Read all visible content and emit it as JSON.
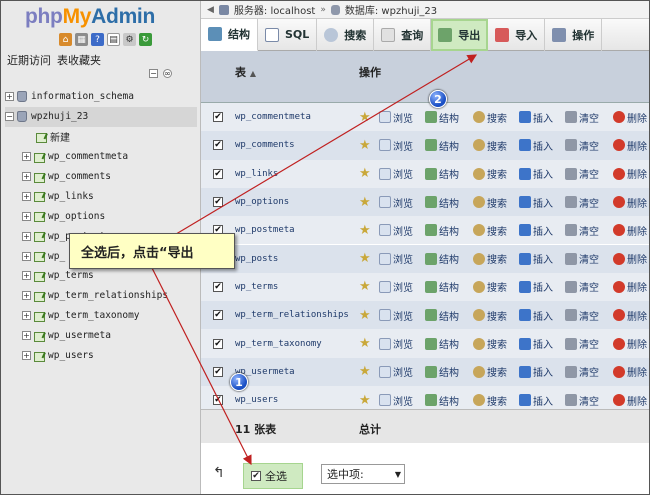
{
  "logo": {
    "php": "php",
    "my": "My",
    "admin": "Admin"
  },
  "sidebar": {
    "recent": "近期访问",
    "favorites": "表收藏夹",
    "tree": {
      "db_info_schema": "information_schema",
      "db_current": "wpzhuji_23",
      "new": "新建",
      "tables": [
        "wp_commentmeta",
        "wp_comments",
        "wp_links",
        "wp_options",
        "wp_postmeta",
        "wp_",
        "wp_terms",
        "wp_term_relationships",
        "wp_term_taxonomy",
        "wp_usermeta",
        "wp_users"
      ]
    }
  },
  "breadcrumb": {
    "server": "服务器: localhost",
    "database": "数据库: wpzhuji_23"
  },
  "tabs": [
    {
      "label": "结构",
      "icon": "structure-icon"
    },
    {
      "label": "SQL",
      "icon": "sql-icon"
    },
    {
      "label": "搜索",
      "icon": "search-icon"
    },
    {
      "label": "查询",
      "icon": "query-icon"
    },
    {
      "label": "导出",
      "icon": "export-icon"
    },
    {
      "label": "导入",
      "icon": "import-icon"
    },
    {
      "label": "操作",
      "icon": "wrench-icon"
    }
  ],
  "table": {
    "col_table": "表",
    "col_actions": "操作",
    "rows": [
      "wp_commentmeta",
      "wp_comments",
      "wp_links",
      "wp_options",
      "wp_postmeta",
      "wp_posts",
      "wp_terms",
      "wp_term_relationships",
      "wp_term_taxonomy",
      "wp_usermeta",
      "wp_users"
    ],
    "actions": {
      "browse": "浏览",
      "structure": "结构",
      "search": "搜索",
      "insert": "插入",
      "empty": "清空",
      "drop": "删除"
    },
    "footer_count": "11 张表",
    "footer_total": "总计"
  },
  "bottom": {
    "check_all": "全选",
    "with_selected": "选中项:"
  },
  "annotation": {
    "callout": "全选后，点击“导出",
    "badge1": "1",
    "badge2": "2"
  }
}
